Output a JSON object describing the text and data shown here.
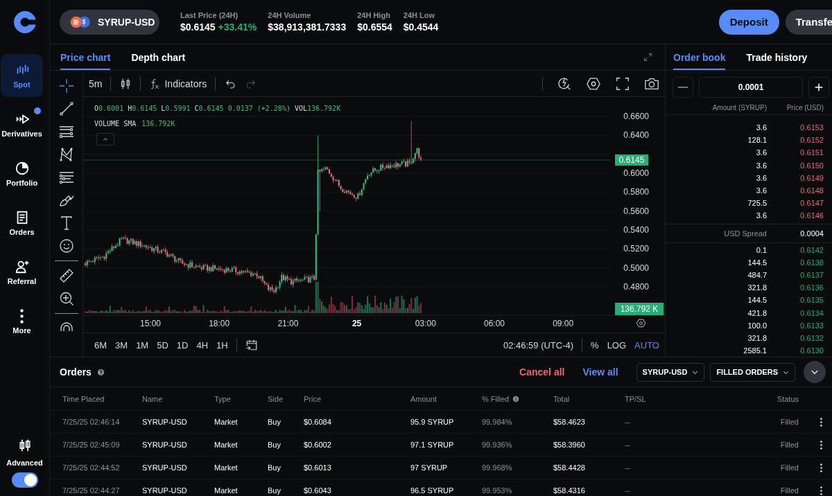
{
  "sidebar": {
    "nav": [
      {
        "kind": "spot",
        "label": "Spot",
        "selected": true,
        "badge": false
      },
      {
        "kind": "derivatives",
        "label": "Derivatives",
        "selected": false,
        "badge": true
      },
      {
        "kind": "portfolio",
        "label": "Portfolio",
        "selected": false,
        "badge": false
      },
      {
        "kind": "orders",
        "label": "Orders",
        "selected": false,
        "badge": false
      },
      {
        "kind": "referral",
        "label": "Referral",
        "selected": false,
        "badge": false
      },
      {
        "kind": "more",
        "label": "More",
        "selected": false,
        "badge": false
      }
    ],
    "advanced": {
      "label": "Advanced",
      "on": true
    }
  },
  "header": {
    "product": "SYRUP-USD",
    "stats": [
      {
        "label": "Last Price (24H)",
        "value": "$0.6145",
        "change": "+33.41%"
      },
      {
        "label": "24H Volume",
        "value": "$38,913,381.7333"
      },
      {
        "label": "24H High",
        "value": "$0.6554"
      },
      {
        "label": "24H Low",
        "value": "$0.4544"
      }
    ],
    "buttons": [
      {
        "kind": "primary",
        "label": "Deposit"
      },
      {
        "kind": "secondary",
        "label": "Transfe"
      }
    ]
  },
  "chart_panel": {
    "tabs": [
      {
        "label": "Price chart",
        "selected": true
      },
      {
        "label": "Depth chart",
        "selected": false
      }
    ],
    "toolbar": {
      "interval": "5m",
      "indicators": "Indicators",
      "redo_disabled": true
    },
    "drawing_tools": [
      {
        "kind": "crosshair",
        "selected": true
      },
      {
        "kind": "trend-line",
        "selected": false
      },
      {
        "kind": "horizontal-lines",
        "selected": false
      },
      {
        "kind": "pattern",
        "selected": false
      },
      {
        "kind": "fib",
        "selected": false
      },
      {
        "kind": "brush",
        "selected": false
      },
      {
        "kind": "text",
        "selected": false
      },
      {
        "kind": "emoji",
        "selected": false
      },
      {
        "kind": "divider"
      },
      {
        "kind": "ruler",
        "selected": false
      },
      {
        "kind": "zoom",
        "selected": false
      },
      {
        "kind": "divider"
      },
      {
        "kind": "magnet",
        "selected": false
      }
    ],
    "legend": {
      "ohlc": [
        {
          "key": "O",
          "value": "0.6001"
        },
        {
          "key": "H",
          "value": "0.6145"
        },
        {
          "key": "L",
          "value": "0.5991"
        },
        {
          "key": "C",
          "value": "0.6145"
        }
      ],
      "change": "0.0137 (+2.28%)",
      "volume": {
        "key": "VOL",
        "value": "136.792K"
      }
    },
    "study": {
      "label": "VOLUME SMA",
      "value": "136.792K"
    },
    "y_axis_upper": [
      "0.6600",
      "0.6400"
    ],
    "y_axis_lower": [
      "0.6000",
      "0.5800",
      "0.5600",
      "0.5400",
      "0.5200",
      "0.5000",
      "0.4800"
    ],
    "price_tag": "0.6145",
    "volume_tag": "136.792 K",
    "x_axis": [
      {
        "label": "15:00",
        "bold": false
      },
      {
        "label": "18:00",
        "bold": false
      },
      {
        "label": "21:00",
        "bold": false
      },
      {
        "label": "25",
        "bold": true
      },
      {
        "label": "03:00",
        "bold": false
      },
      {
        "label": "06:00",
        "bold": false
      },
      {
        "label": "09:00",
        "bold": false
      }
    ],
    "ranges": [
      "6M",
      "3M",
      "1M",
      "5D",
      "1D",
      "4H",
      "1H"
    ],
    "clock": "02:46:59 (UTC-4)",
    "scale_options": [
      {
        "label": "%",
        "selected": false
      },
      {
        "label": "LOG",
        "selected": false
      },
      {
        "label": "AUTO",
        "selected": true
      }
    ]
  },
  "order_book": {
    "tabs": [
      {
        "label": "Order book",
        "selected": true
      },
      {
        "label": "Trade history",
        "selected": false
      }
    ],
    "step": "0.0001",
    "columns": [
      "Amount (SYRUP)",
      "Price (USD)"
    ],
    "asks": [
      {
        "amount": "3.6",
        "price": "0.6153"
      },
      {
        "amount": "128.1",
        "price": "0.6152"
      },
      {
        "amount": "3.6",
        "price": "0.6151"
      },
      {
        "amount": "3.6",
        "price": "0.6150"
      },
      {
        "amount": "3.6",
        "price": "0.6149"
      },
      {
        "amount": "3.6",
        "price": "0.6148"
      },
      {
        "amount": "725.5",
        "price": "0.6147"
      },
      {
        "amount": "3.6",
        "price": "0.6146"
      }
    ],
    "spread": {
      "label": "USD Spread",
      "value": "0.0004"
    },
    "bids": [
      {
        "amount": "0.1",
        "price": "0.6142"
      },
      {
        "amount": "144.5",
        "price": "0.6138"
      },
      {
        "amount": "484.7",
        "price": "0.6137"
      },
      {
        "amount": "321.8",
        "price": "0.6136"
      },
      {
        "amount": "144.5",
        "price": "0.6135"
      },
      {
        "amount": "421.8",
        "price": "0.6134"
      },
      {
        "amount": "100.0",
        "price": "0.6133"
      },
      {
        "amount": "321.8",
        "price": "0.6132"
      },
      {
        "amount": "2585.1",
        "price": "0.6130"
      }
    ]
  },
  "orders": {
    "title": "Orders",
    "actions": [
      {
        "kind": "danger",
        "label": "Cancel all"
      },
      {
        "kind": "link",
        "label": "View all"
      }
    ],
    "filters": [
      "SYRUP-USD",
      "FILLED ORDERS"
    ],
    "columns": [
      {
        "label": "Time Placed"
      },
      {
        "label": "Name"
      },
      {
        "label": "Type"
      },
      {
        "label": "Side"
      },
      {
        "label": "Price"
      },
      {
        "label": "Amount"
      },
      {
        "label": "% Filled",
        "info": true
      },
      {
        "label": "Total"
      },
      {
        "label": "TP/SL"
      },
      {
        "label": "Status"
      }
    ],
    "rows": [
      {
        "time": "7/25/25 02:46:14",
        "name": "SYRUP-USD",
        "type": "Market",
        "side": "Buy",
        "price": "$0.6084",
        "amount": "95.9 SYRUP",
        "filled": "99.984%",
        "total": "$58.4623",
        "tpsl": "--",
        "status": "Filled"
      },
      {
        "time": "7/25/25 02:45:09",
        "name": "SYRUP-USD",
        "type": "Market",
        "side": "Buy",
        "price": "$0.6002",
        "amount": "97.1 SYRUP",
        "filled": "99.936%",
        "total": "$58.3960",
        "tpsl": "--",
        "status": "Filled"
      },
      {
        "time": "7/25/25 02:44:52",
        "name": "SYRUP-USD",
        "type": "Market",
        "side": "Buy",
        "price": "$0.6013",
        "amount": "97 SYRUP",
        "filled": "99.968%",
        "total": "$58.4428",
        "tpsl": "--",
        "status": "Filled"
      },
      {
        "time": "7/25/25 02:44:27",
        "name": "SYRUP-USD",
        "type": "Market",
        "side": "Buy",
        "price": "$0.6043",
        "amount": "96.5 SYRUP",
        "filled": "99.953%",
        "total": "$58.4316",
        "tpsl": "--",
        "status": "Filled"
      }
    ]
  }
}
